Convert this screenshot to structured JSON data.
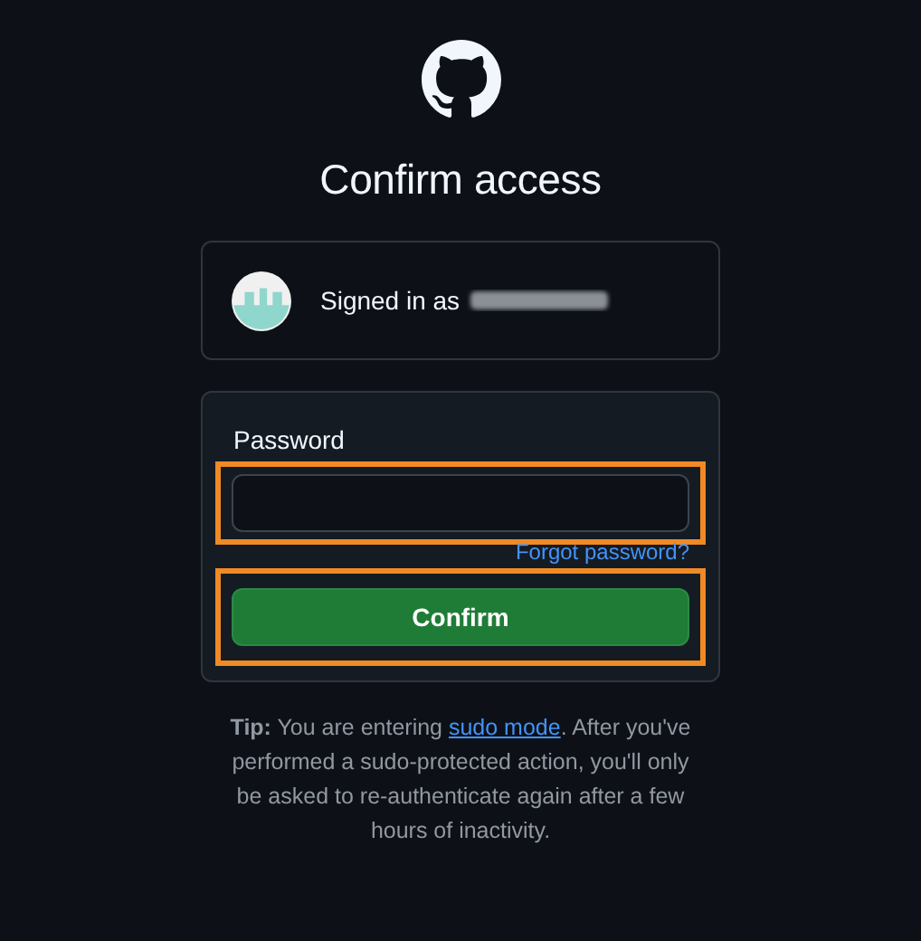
{
  "title": "Confirm access",
  "account": {
    "label": "Signed in as"
  },
  "form": {
    "password_label": "Password",
    "password_field": {
      "highlighted": true
    },
    "forgot_link": "Forgot password?",
    "confirm_button": {
      "label": "Confirm",
      "highlighted": true
    }
  },
  "tip": {
    "text": "**Tip:** You are entering ",
    "link": "sudo mode",
    "rest": ". After you've performed a sudo-protected action, you'll only be asked to re-authenticate again after a few hours of inactivity."
  }
}
